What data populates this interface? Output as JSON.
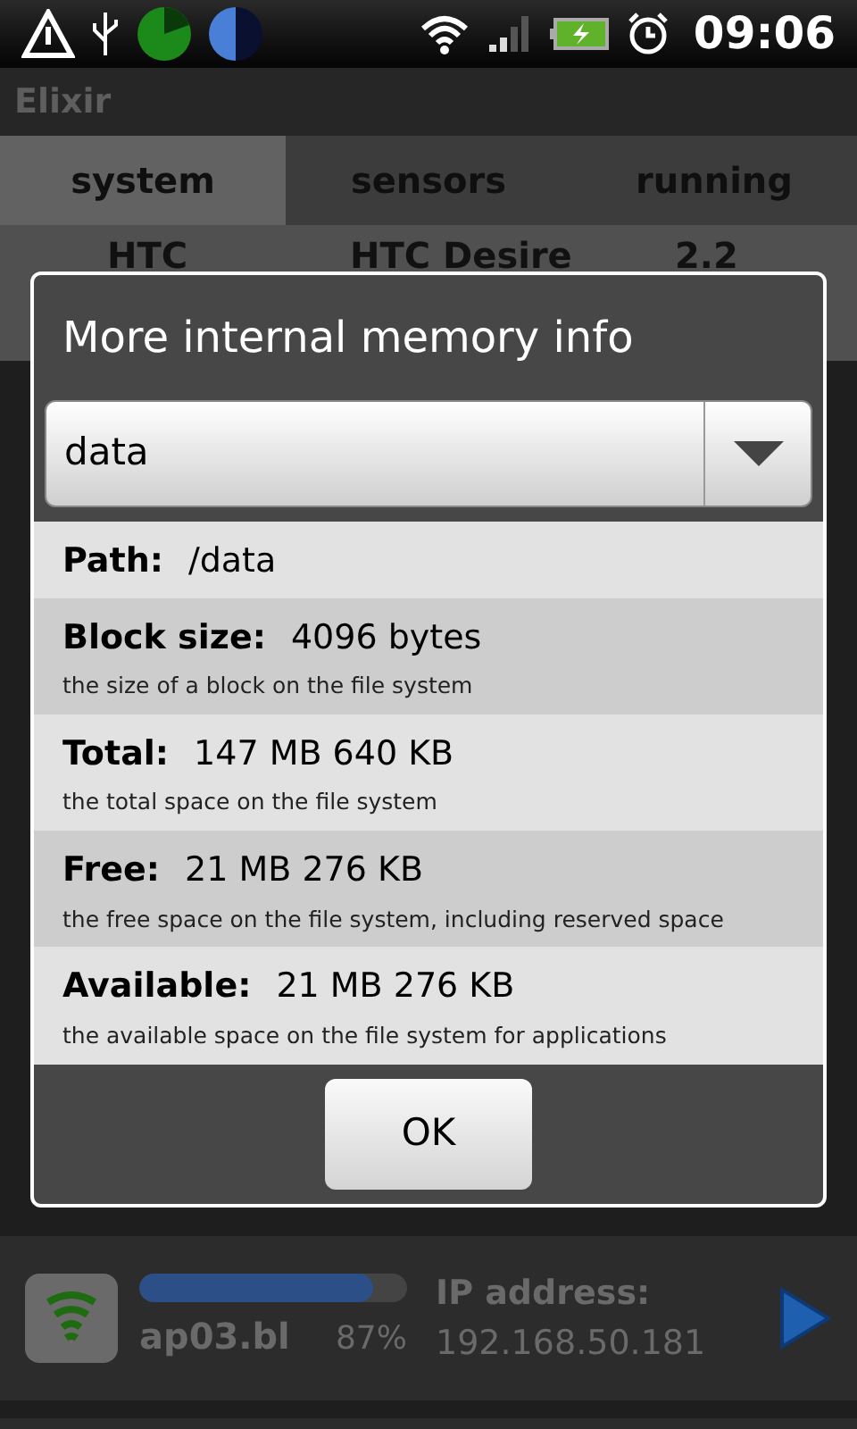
{
  "status_bar": {
    "time": "09:06"
  },
  "app_title": "Elixir",
  "tabs": [
    {
      "label": "system",
      "selected": true
    },
    {
      "label": "sensors",
      "selected": false
    },
    {
      "label": "running",
      "selected": false
    }
  ],
  "device_row": {
    "cells": [
      "HTC",
      "HTC Desire",
      "2.2"
    ]
  },
  "dialog": {
    "title": "More internal memory info",
    "dropdown": {
      "value": "data"
    },
    "fields": [
      {
        "label": "Path:",
        "value": "/data"
      },
      {
        "label": "Block size:",
        "value": "4096 bytes",
        "description": "the size of a block on the file system"
      },
      {
        "label": "Total:",
        "value": "147 MB 640 KB",
        "description": "the total space on the file system"
      },
      {
        "label": "Free:",
        "value": "21 MB 276 KB",
        "description": "the free space on the file system, including reserved space"
      },
      {
        "label": "Available:",
        "value": "21 MB 276 KB",
        "description": "the available space on the file system for applications"
      }
    ],
    "buttons": [
      "OK"
    ]
  },
  "network_row": {
    "name": "ap03.bl",
    "level": 0.87,
    "percent": "87%",
    "label": "IP address:",
    "value": "192.168.50.181"
  }
}
